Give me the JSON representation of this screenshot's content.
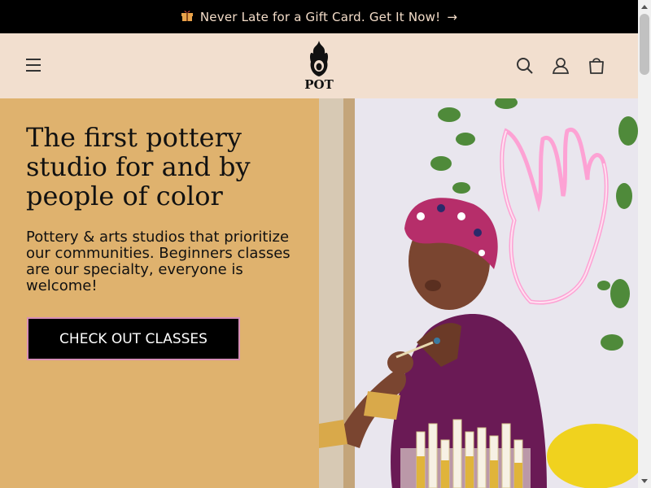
{
  "announcement": {
    "text": "Never Late for a Gift Card. Get It Now!",
    "arrow": "→",
    "icon": "gift-icon"
  },
  "header": {
    "logo_text": "POT",
    "icons": [
      "menu-icon",
      "search-icon",
      "account-icon",
      "cart-icon"
    ]
  },
  "hero": {
    "title": "The first pottery studio for and by people of color",
    "subtitle": "Pottery & arts studios that prioritize our communities. Beginners classes are our specialty, everyone is welcome!",
    "cta_label": "CHECK OUT CLASSES"
  },
  "colors": {
    "announcement_bg": "#000000",
    "header_bg": "#f2dfcf",
    "hero_bg": "#dfb26e",
    "button_bg": "#000000",
    "button_border": "#d78fb7"
  }
}
